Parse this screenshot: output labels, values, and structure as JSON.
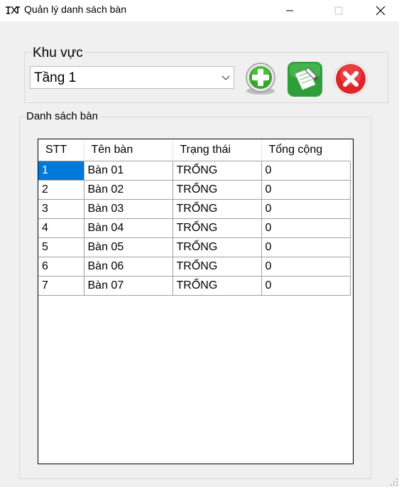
{
  "window": {
    "title": "Quản lý danh sách bàn"
  },
  "area": {
    "label": "Khu vực",
    "selected": "Tầng 1"
  },
  "toolbar": {
    "add_icon": "plus-circle-icon",
    "edit_icon": "edit-note-icon",
    "delete_icon": "close-circle-icon"
  },
  "table_list": {
    "label": "Danh sách bàn",
    "columns": [
      "STT",
      "Tên bàn",
      "Trạng thái",
      "Tổng cộng"
    ],
    "rows": [
      [
        "1",
        "Bàn 01",
        "TRỐNG",
        "0"
      ],
      [
        "2",
        "Bàn 02",
        "TRỐNG",
        "0"
      ],
      [
        "3",
        "Bàn 03",
        "TRỐNG",
        "0"
      ],
      [
        "4",
        "Bàn 04",
        "TRỐNG",
        "0"
      ],
      [
        "5",
        "Bàn 05",
        "TRỐNG",
        "0"
      ],
      [
        "6",
        "Bàn 06",
        "TRỐNG",
        "0"
      ],
      [
        "7",
        "Bàn 07",
        "TRỐNG",
        "0"
      ]
    ]
  },
  "colors": {
    "selection": "#0078d7",
    "add_green": "#3aa52d",
    "edit_green": "#2e9e3a",
    "delete_red": "#e0252a"
  }
}
